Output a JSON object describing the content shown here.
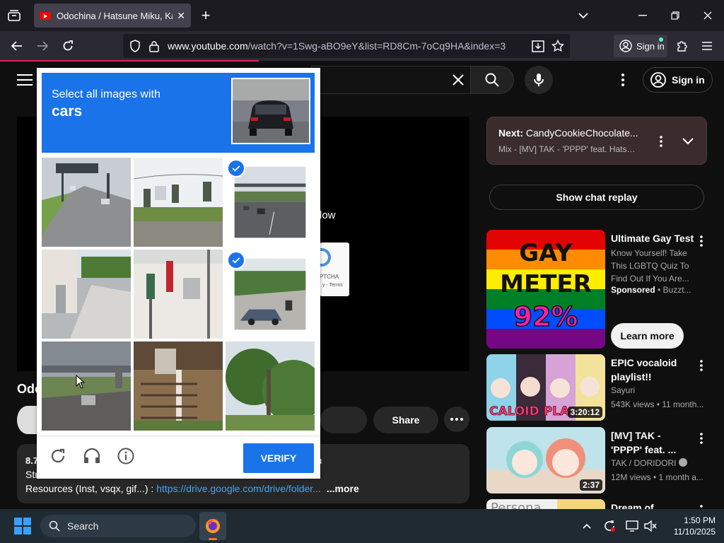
{
  "browser": {
    "tab_title": "Odochina / Hatsune Miku, Kasane",
    "tab_close": "✕",
    "new_tab": "+",
    "url_host": "www.youtube.com",
    "url_rest": "/watch?v=1Swg-aBO9eY&list=RD8Cm-7oCq9HA&index=3",
    "signin_label": "Sign in"
  },
  "youtube": {
    "signin_label": "Sign in",
    "player_partial_text": "low",
    "recaptcha_badge_text": "PTCHA",
    "recaptcha_badge_terms": "y - Terms",
    "video_title_partial": "Odo",
    "share_label": "Share",
    "description": {
      "views_partial": "8.7",
      "line2_partial": "Str",
      "line3_label": "Resources (Inst, vsqx, gif...) : ",
      "line3_link": "https://drive.google.com/drive/folder...",
      "more_label": "...more",
      "right_partial": "u"
    },
    "up_next": {
      "label": "Next:",
      "title": "CandyCookieChocolate...",
      "subtitle": "Mix - [MV] TAK - 'PPPP' feat. Hatsun..."
    },
    "chat_replay_label": "Show chat replay",
    "recommendations": [
      {
        "title": "Ultimate Gay Test",
        "description": "Know Yourself! Take This LGBTQ Quiz To Find Out If You Are...",
        "sponsored_label": "Sponsored",
        "advertiser": "Buzzt...",
        "cta": "Learn more",
        "thumb_text_1": "GAY",
        "thumb_text_2": "METER",
        "thumb_text_3": "92%"
      },
      {
        "title": "EPIC vocaloid playlist!!",
        "channel": "Sayuri",
        "meta": "543K views • 11 month...",
        "duration": "3:20:12",
        "thumb_text": "CALOID PLA"
      },
      {
        "title": "[MV] TAK - 'PPPP' feat. ...",
        "channel": "TAK / DORIDORI",
        "meta": "12M views • 1 month a...",
        "duration": "2:37"
      },
      {
        "title": "Dream of",
        "thumb_text": "Persona"
      }
    ]
  },
  "captcha": {
    "instruction": "Select all images with",
    "target": "cars",
    "verify_label": "VERIFY",
    "tiles": [
      {
        "index": 0,
        "selected": false
      },
      {
        "index": 1,
        "selected": false
      },
      {
        "index": 2,
        "selected": true
      },
      {
        "index": 3,
        "selected": false
      },
      {
        "index": 4,
        "selected": false
      },
      {
        "index": 5,
        "selected": true
      },
      {
        "index": 6,
        "selected": false
      },
      {
        "index": 7,
        "selected": false
      },
      {
        "index": 8,
        "selected": false
      }
    ]
  },
  "taskbar": {
    "search_label": "Search",
    "time": "1:50 PM",
    "date": "11/10/2025"
  },
  "colors": {
    "recaptcha_blue": "#1a73e8",
    "youtube_bg": "#0f0f0f",
    "link_blue": "#3ea6ff"
  }
}
